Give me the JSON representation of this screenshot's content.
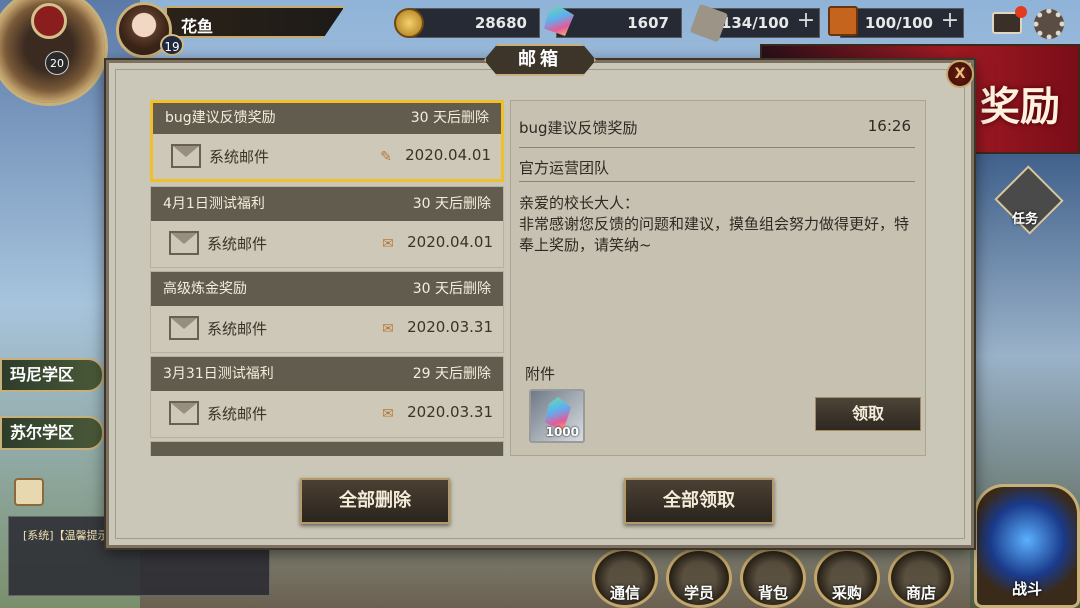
{
  "player": {
    "name": "花鱼",
    "level": "19",
    "clock_number": "20"
  },
  "resources": {
    "coins": "28680",
    "gems": "1607",
    "stamina": "134/100",
    "books": "100/100"
  },
  "banner": {
    "text": "奖励"
  },
  "modal": {
    "title": "邮箱",
    "close_label": "X",
    "delete_all": "全部删除",
    "claim_all": "全部领取"
  },
  "mails": [
    {
      "title": "bug建议反馈奖励",
      "expire": "30 天后删除",
      "type": "系统邮件",
      "date": "2020.04.01",
      "icon": "paperclip-icon",
      "selected": true
    },
    {
      "title": "4月1日测试福利",
      "expire": "30 天后删除",
      "type": "系统邮件",
      "date": "2020.04.01",
      "icon": "opened-attachment-icon",
      "selected": false
    },
    {
      "title": "高级炼金奖励",
      "expire": "30 天后删除",
      "type": "系统邮件",
      "date": "2020.03.31",
      "icon": "opened-attachment-icon",
      "selected": false
    },
    {
      "title": "3月31日测试福利",
      "expire": "29 天后删除",
      "type": "系统邮件",
      "date": "2020.03.31",
      "icon": "opened-attachment-icon",
      "selected": false
    }
  ],
  "detail": {
    "title": "bug建议反馈奖励",
    "time": "16:26",
    "sender": "官方运营团队",
    "greeting": "亲爱的校长大人：",
    "body": "非常感谢您反馈的问题和建议，摸鱼组会努力做得更好，特奉上奖励，请笑纳~",
    "attachment_label": "附件",
    "attachment_count": "1000",
    "claim_label": "领取"
  },
  "side": {
    "zone1": "玛尼学区",
    "zone2": "苏尔学区",
    "task": "任务"
  },
  "chat": {
    "text": "[系统]【温馨提示"
  },
  "nav": {
    "comms": "通信",
    "students": "学员",
    "bag": "背包",
    "purchase": "采购",
    "shop": "商店",
    "battle": "战斗"
  }
}
